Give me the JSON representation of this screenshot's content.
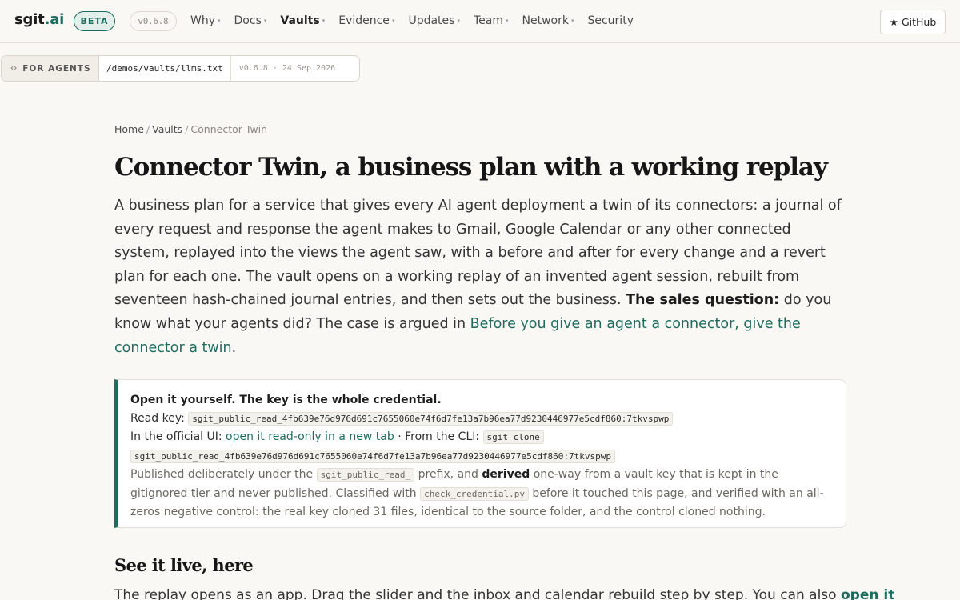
{
  "brand": {
    "name": "sgit",
    "dot": ".ai",
    "badge": "BETA",
    "version": "v0.6.8"
  },
  "nav": {
    "items": [
      {
        "label": "Why",
        "caret": true
      },
      {
        "label": "Docs",
        "caret": true
      },
      {
        "label": "Vaults",
        "caret": true,
        "active": true
      },
      {
        "label": "Evidence",
        "caret": true
      },
      {
        "label": "Updates",
        "caret": true
      },
      {
        "label": "Team",
        "caret": true
      },
      {
        "label": "Network",
        "caret": true
      },
      {
        "label": "Security",
        "caret": false
      }
    ],
    "github": "GitHub"
  },
  "agent_bar": {
    "label": "FOR AGENTS",
    "path": "/demos/vaults/llms.txt",
    "meta": "v0.6.8 · 24 Sep 2026"
  },
  "breadcrumb": {
    "home": "Home",
    "vaults": "Vaults",
    "current": "Connector Twin"
  },
  "title": "Connector Twin, a business plan with a working replay",
  "lede": {
    "text": "A business plan for a service that gives every AI agent deployment a twin of its connectors: a journal of every request and response the agent makes to Gmail, Google Calendar or any other connected system, replayed into the views the agent saw, with a before and after for every change and a revert plan for each one. The vault opens on a working replay of an invented agent session, rebuilt from seventeen hash-chained journal entries, and then sets out the business.",
    "strong": "The sales question:",
    "question": "do you know what your agents did? The case is argued in",
    "link": "Before you give an agent a connector, give the connector a twin",
    "end": "."
  },
  "keybox": {
    "title": "Open it yourself. The key is the whole credential.",
    "read_key_label": "Read key:",
    "read_key": "sgit_public_read_4fb639e76d976d691c7655060e74f6d7fe13a7b96ea77d9230446977e5cdf860:7tkvspwp",
    "ui_label": "In the official UI:",
    "ui_link": "open it read-only in a new tab",
    "cli_label": "· From the CLI:",
    "cli_cmd": "sgit clone",
    "cli_key": "sgit_public_read_4fb639e76d976d691c7655060e74f6d7fe13a7b96ea77d9230446977e5cdf860:7tkvspwp",
    "p1": "Published deliberately under the",
    "prefix": "sgit_public_read_",
    "p2": "prefix, and",
    "derived": "derived",
    "p3": "one-way from a vault key that is kept in the gitignored tier and never published. Classified with",
    "checker": "check_credential.py",
    "p4": "before it touched this page, and verified with an all-zeros negative control: the real key cloned 31 files, identical to the source folder, and the control cloned nothing."
  },
  "section": {
    "heading": "See it live, here",
    "text": "The replay opens as an app. Drag the slider and the inbox and calendar rebuild step by step. You can also",
    "link": "open it"
  }
}
